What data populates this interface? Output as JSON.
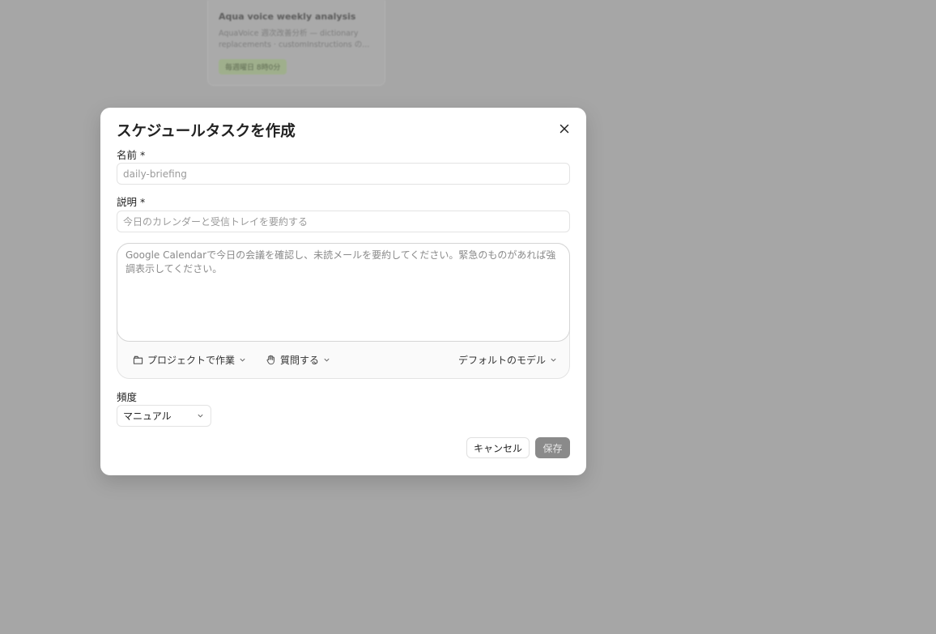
{
  "background": {
    "card": {
      "title": "Aqua voice weekly analysis",
      "description": "AquaVoice 週次改善分析 — dictionary replacements · customInstructions の...",
      "badge": "毎週曜日 8時0分"
    }
  },
  "modal": {
    "title": "スケジュールタスクを作成",
    "name_label": "名前 *",
    "name_placeholder": "daily-briefing",
    "description_label": "説明 *",
    "description_placeholder": "今日のカレンダーと受信トレイを要約する",
    "prompt_placeholder": "Google Calendarで今日の会議を確認し、未読メールを要約してください。緊急のものがあれば強調表示してください。",
    "toolbar": {
      "project_label": "プロジェクトで作業",
      "ask_label": "質問する",
      "model_label": "デフォルトのモデル"
    },
    "frequency_label": "頻度",
    "frequency_value": "マニュアル",
    "cancel_label": "キャンセル",
    "save_label": "保存"
  },
  "colors": {
    "overlay": "#a6a6a6",
    "save_button": "#8a8a8a",
    "badge": "#9fb08a"
  },
  "icons": {
    "close": "close-icon",
    "project": "folder-icon",
    "ask": "hand-icon",
    "chevron": "chevron-down-icon"
  }
}
